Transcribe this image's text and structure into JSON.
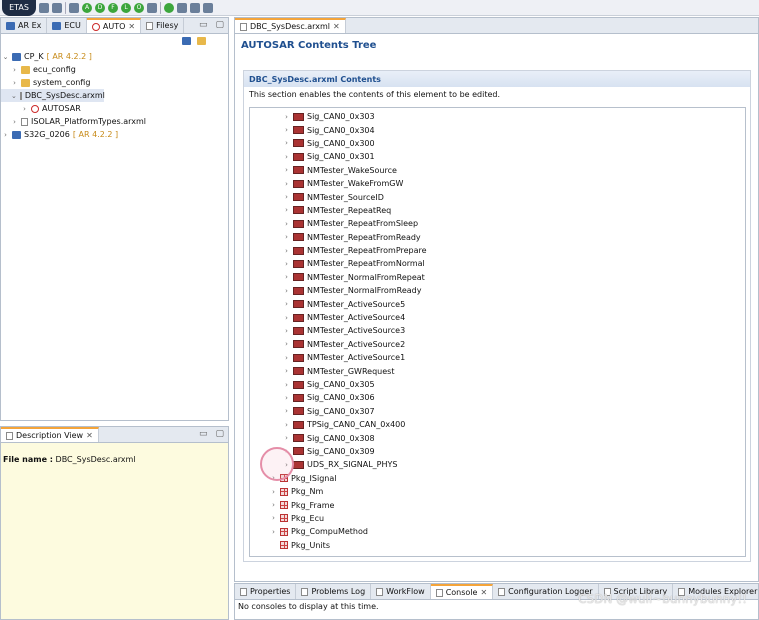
{
  "toolbar": {
    "logo_text": "ETAS"
  },
  "explorer": {
    "tabs": [
      {
        "label": "AR Ex"
      },
      {
        "label": "ECU"
      },
      {
        "label": "AUTO"
      },
      {
        "label": "Filesy"
      }
    ],
    "tree": [
      {
        "label": "CP_K",
        "tag": "[ AR 4.2.2 ]"
      },
      {
        "label": "ecu_config"
      },
      {
        "label": "system_config"
      },
      {
        "label": "DBC_SysDesc.arxml"
      },
      {
        "label": "AUTOSAR"
      },
      {
        "label": "ISOLAR_PlatformTypes.arxml"
      },
      {
        "label": "S32G_0206",
        "tag": "[ AR 4.2.2 ]"
      }
    ]
  },
  "description_view": {
    "tab_label": "Description View",
    "file_label": "File name :",
    "file_value": "DBC_SysDesc.arxml"
  },
  "editor": {
    "tab_label": "DBC_SysDesc.arxml",
    "title": "AUTOSAR Contents Tree",
    "section_title": "DBC_SysDesc.arxml Contents",
    "section_desc": "This section enables the contents of this element to be edited.",
    "signals": [
      "Sig_CAN0_0x303",
      "Sig_CAN0_0x304",
      "Sig_CAN0_0x300",
      "Sig_CAN0_0x301",
      "NMTester_WakeSource",
      "NMTester_WakeFromGW",
      "NMTester_SourceID",
      "NMTester_RepeatReq",
      "NMTester_RepeatFromSleep",
      "NMTester_RepeatFromReady",
      "NMTester_RepeatFromPrepare",
      "NMTester_RepeatFromNormal",
      "NMTester_NormalFromRepeat",
      "NMTester_NormalFromReady",
      "NMTester_ActiveSource5",
      "NMTester_ActiveSource4",
      "NMTester_ActiveSource3",
      "NMTester_ActiveSource2",
      "NMTester_ActiveSource1",
      "NMTester_GWRequest",
      "Sig_CAN0_0x305",
      "Sig_CAN0_0x306",
      "Sig_CAN0_0x307",
      "TPSig_CAN0_CAN_0x400",
      "Sig_CAN0_0x308",
      "Sig_CAN0_0x309",
      "UDS_RX_SIGNAL_PHYS"
    ],
    "packages": [
      "Pkg_ISignal",
      "Pkg_Nm",
      "Pkg_Frame",
      "Pkg_Ecu",
      "Pkg_CompuMethod",
      "Pkg_Units"
    ]
  },
  "bottom": {
    "tabs": [
      {
        "label": "Properties"
      },
      {
        "label": "Problems Log"
      },
      {
        "label": "WorkFlow"
      },
      {
        "label": "Console"
      },
      {
        "label": "Configuration Logger"
      },
      {
        "label": "Script Library"
      },
      {
        "label": "Modules Explorer"
      }
    ],
    "console_message": "No consoles to display at this time."
  },
  "watermark": "CSDN @wuli~bunnybunny!!"
}
